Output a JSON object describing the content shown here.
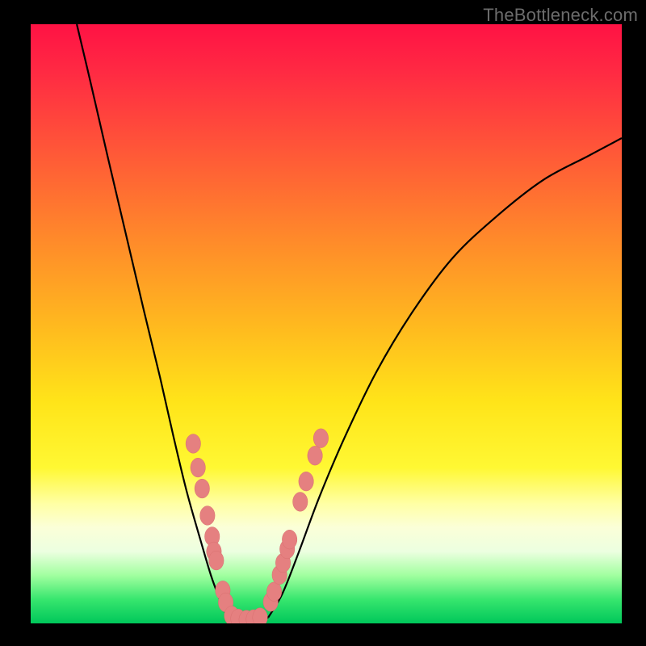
{
  "watermark": "TheBottleneck.com",
  "colors": {
    "dot_fill": "#e58080",
    "dot_stroke": "#d96f6f",
    "curve_stroke": "#000000",
    "frame": "#000000"
  },
  "chart_data": {
    "type": "line",
    "title": "",
    "xlabel": "",
    "ylabel": "",
    "xlim": [
      0,
      100
    ],
    "ylim": [
      0,
      100
    ],
    "grid": false,
    "legend": false,
    "note": "V-shaped curve on a vertical red→yellow→green gradient. Axes carry no tick labels or numeric annotations in the source image — curve and dot coordinates below are read off the pixel plot area and normalised to 0–100.",
    "series": [
      {
        "name": "left-branch",
        "x": [
          7.8,
          10.2,
          13.0,
          16.1,
          19.2,
          21.9,
          24.2,
          26.4,
          28.7,
          30.5,
          32.0,
          33.3
        ],
        "y": [
          100.0,
          90.0,
          78.0,
          65.0,
          52.0,
          41.0,
          31.0,
          22.0,
          14.0,
          8.0,
          4.0,
          1.0
        ]
      },
      {
        "name": "valley",
        "x": [
          33.3,
          34.7,
          36.1,
          37.4,
          38.8,
          40.2
        ],
        "y": [
          1.0,
          0.3,
          0.1,
          0.1,
          0.3,
          1.0
        ]
      },
      {
        "name": "right-branch",
        "x": [
          40.2,
          42.6,
          45.4,
          48.8,
          53.1,
          58.5,
          64.6,
          71.4,
          78.9,
          86.7,
          94.3,
          100.0
        ],
        "y": [
          1.0,
          5.0,
          12.0,
          21.0,
          31.0,
          42.0,
          52.0,
          61.0,
          68.0,
          74.0,
          78.0,
          81.0
        ]
      }
    ],
    "dots": {
      "name": "scatter-markers",
      "r": 1.2,
      "points": [
        {
          "x": 27.5,
          "y": 30.0
        },
        {
          "x": 28.3,
          "y": 26.0
        },
        {
          "x": 29.0,
          "y": 22.5
        },
        {
          "x": 29.9,
          "y": 18.0
        },
        {
          "x": 30.7,
          "y": 14.5
        },
        {
          "x": 31.0,
          "y": 12.0
        },
        {
          "x": 31.4,
          "y": 10.5
        },
        {
          "x": 32.5,
          "y": 5.5
        },
        {
          "x": 33.0,
          "y": 3.5
        },
        {
          "x": 34.0,
          "y": 1.3
        },
        {
          "x": 35.1,
          "y": 0.8
        },
        {
          "x": 36.5,
          "y": 0.6
        },
        {
          "x": 37.7,
          "y": 0.7
        },
        {
          "x": 38.8,
          "y": 1.0
        },
        {
          "x": 40.6,
          "y": 3.6
        },
        {
          "x": 41.2,
          "y": 5.3
        },
        {
          "x": 42.1,
          "y": 8.1
        },
        {
          "x": 42.7,
          "y": 10.1
        },
        {
          "x": 43.4,
          "y": 12.4
        },
        {
          "x": 43.8,
          "y": 14.0
        },
        {
          "x": 45.6,
          "y": 20.3
        },
        {
          "x": 46.6,
          "y": 23.7
        },
        {
          "x": 48.1,
          "y": 28.0
        },
        {
          "x": 49.1,
          "y": 30.9
        }
      ]
    }
  }
}
